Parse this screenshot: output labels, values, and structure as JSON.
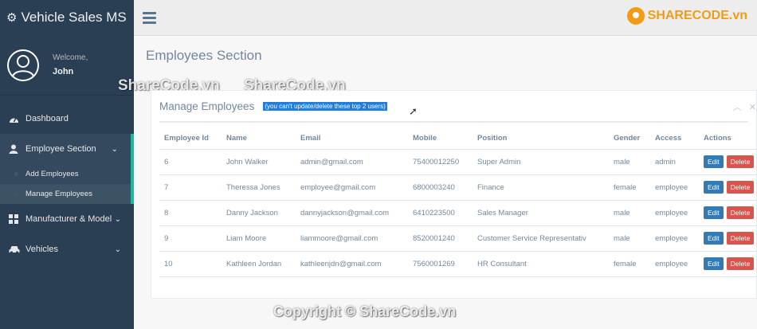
{
  "brand": {
    "title": "Vehicle Sales MS"
  },
  "profile": {
    "welcome": "Welcome,",
    "name": "John"
  },
  "sidebar": {
    "items": [
      {
        "label": "Dashboard",
        "icon": "dashboard-icon"
      },
      {
        "label": "Employee Section",
        "icon": "user-icon"
      },
      {
        "label": "Manufacturer & Model",
        "icon": "grid-icon"
      },
      {
        "label": "Vehicles",
        "icon": "car-icon"
      }
    ],
    "subitems": [
      {
        "label": "Add Employees"
      },
      {
        "label": "Manage Employees"
      }
    ]
  },
  "topbar": {
    "logo_text": "SHARECODE.vn"
  },
  "page": {
    "title": "Employees Section"
  },
  "panel": {
    "title": "Manage Employees",
    "note": "(you can't update/delete these top 2 users)"
  },
  "table": {
    "headers": [
      "Employee Id",
      "Name",
      "Email",
      "Mobile",
      "Position",
      "Gender",
      "Access",
      "Actions"
    ],
    "rows": [
      [
        "6",
        "John Walker",
        "admin@gmail.com",
        "75400012250",
        "Super Admin",
        "male",
        "admin"
      ],
      [
        "7",
        "Theressa Jones",
        "employee@gmail.com",
        "6800003240",
        "Finance",
        "female",
        "employee"
      ],
      [
        "8",
        "Danny Jackson",
        "dannyjackson@gmail.com",
        "6410223500",
        "Sales Manager",
        "male",
        "employee"
      ],
      [
        "9",
        "Liam Moore",
        "liammoore@gmail.com",
        "8520001240",
        "Customer Service Representativ",
        "male",
        "employee"
      ],
      [
        "10",
        "Kathleen Jordan",
        "kathleenjdn@gmail.com",
        "7560001269",
        "HR Consultant",
        "female",
        "employee"
      ]
    ],
    "edit_label": "Edit",
    "delete_label": "Delete"
  },
  "watermarks": {
    "a": "ShareCode.vn",
    "b": "ShareCode.vn",
    "c": "Copyright © ShareCode.vn"
  },
  "colors": {
    "sidebar": "#2a3f54",
    "accent": "#1abb9c",
    "edit": "#337ab7",
    "delete": "#d9534f"
  }
}
